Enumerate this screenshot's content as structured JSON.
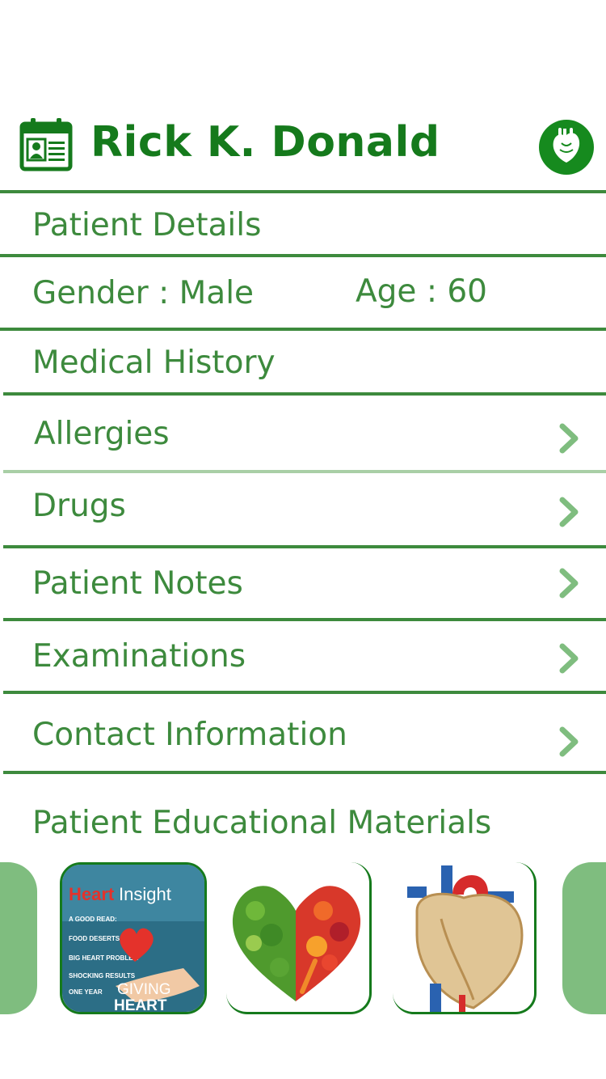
{
  "header": {
    "patient_name": "Rick K. Donald",
    "id_icon": "id-card-calendar-icon",
    "badge_icon": "anatomical-heart-icon"
  },
  "details": {
    "section_title": "Patient Details",
    "gender": "Gender : Male",
    "age": "Age : 60"
  },
  "history": {
    "section_title": "Medical History",
    "items": [
      {
        "label": "Allergies",
        "icon": "chevron-right-icon"
      },
      {
        "label": "Drugs",
        "icon": "chevron-right-icon"
      },
      {
        "label": "Patient Notes",
        "icon": "chevron-right-icon"
      },
      {
        "label": "Examinations",
        "icon": "chevron-right-icon"
      },
      {
        "label": "Contact Information",
        "icon": "chevron-right-icon"
      }
    ]
  },
  "materials": {
    "section_title": "Patient Educational Materials",
    "magazine": {
      "brand_heart": "Heart",
      "brand_insight": "Insight",
      "cover_lines": [
        "A GOOD READ:",
        "FOOD DESERTS",
        "BIG HEART PROBLEM",
        "SHOCKING RESULTS",
        "ONE YEAR"
      ],
      "bottom_line1": "GIVING",
      "bottom_line2": "HEART"
    }
  },
  "colors": {
    "primary": "#157a1c",
    "text": "#3d8a3d",
    "rule": "#3d8a3d",
    "rule_light": "#a9cfa6",
    "pill": "#7fbd7f"
  }
}
